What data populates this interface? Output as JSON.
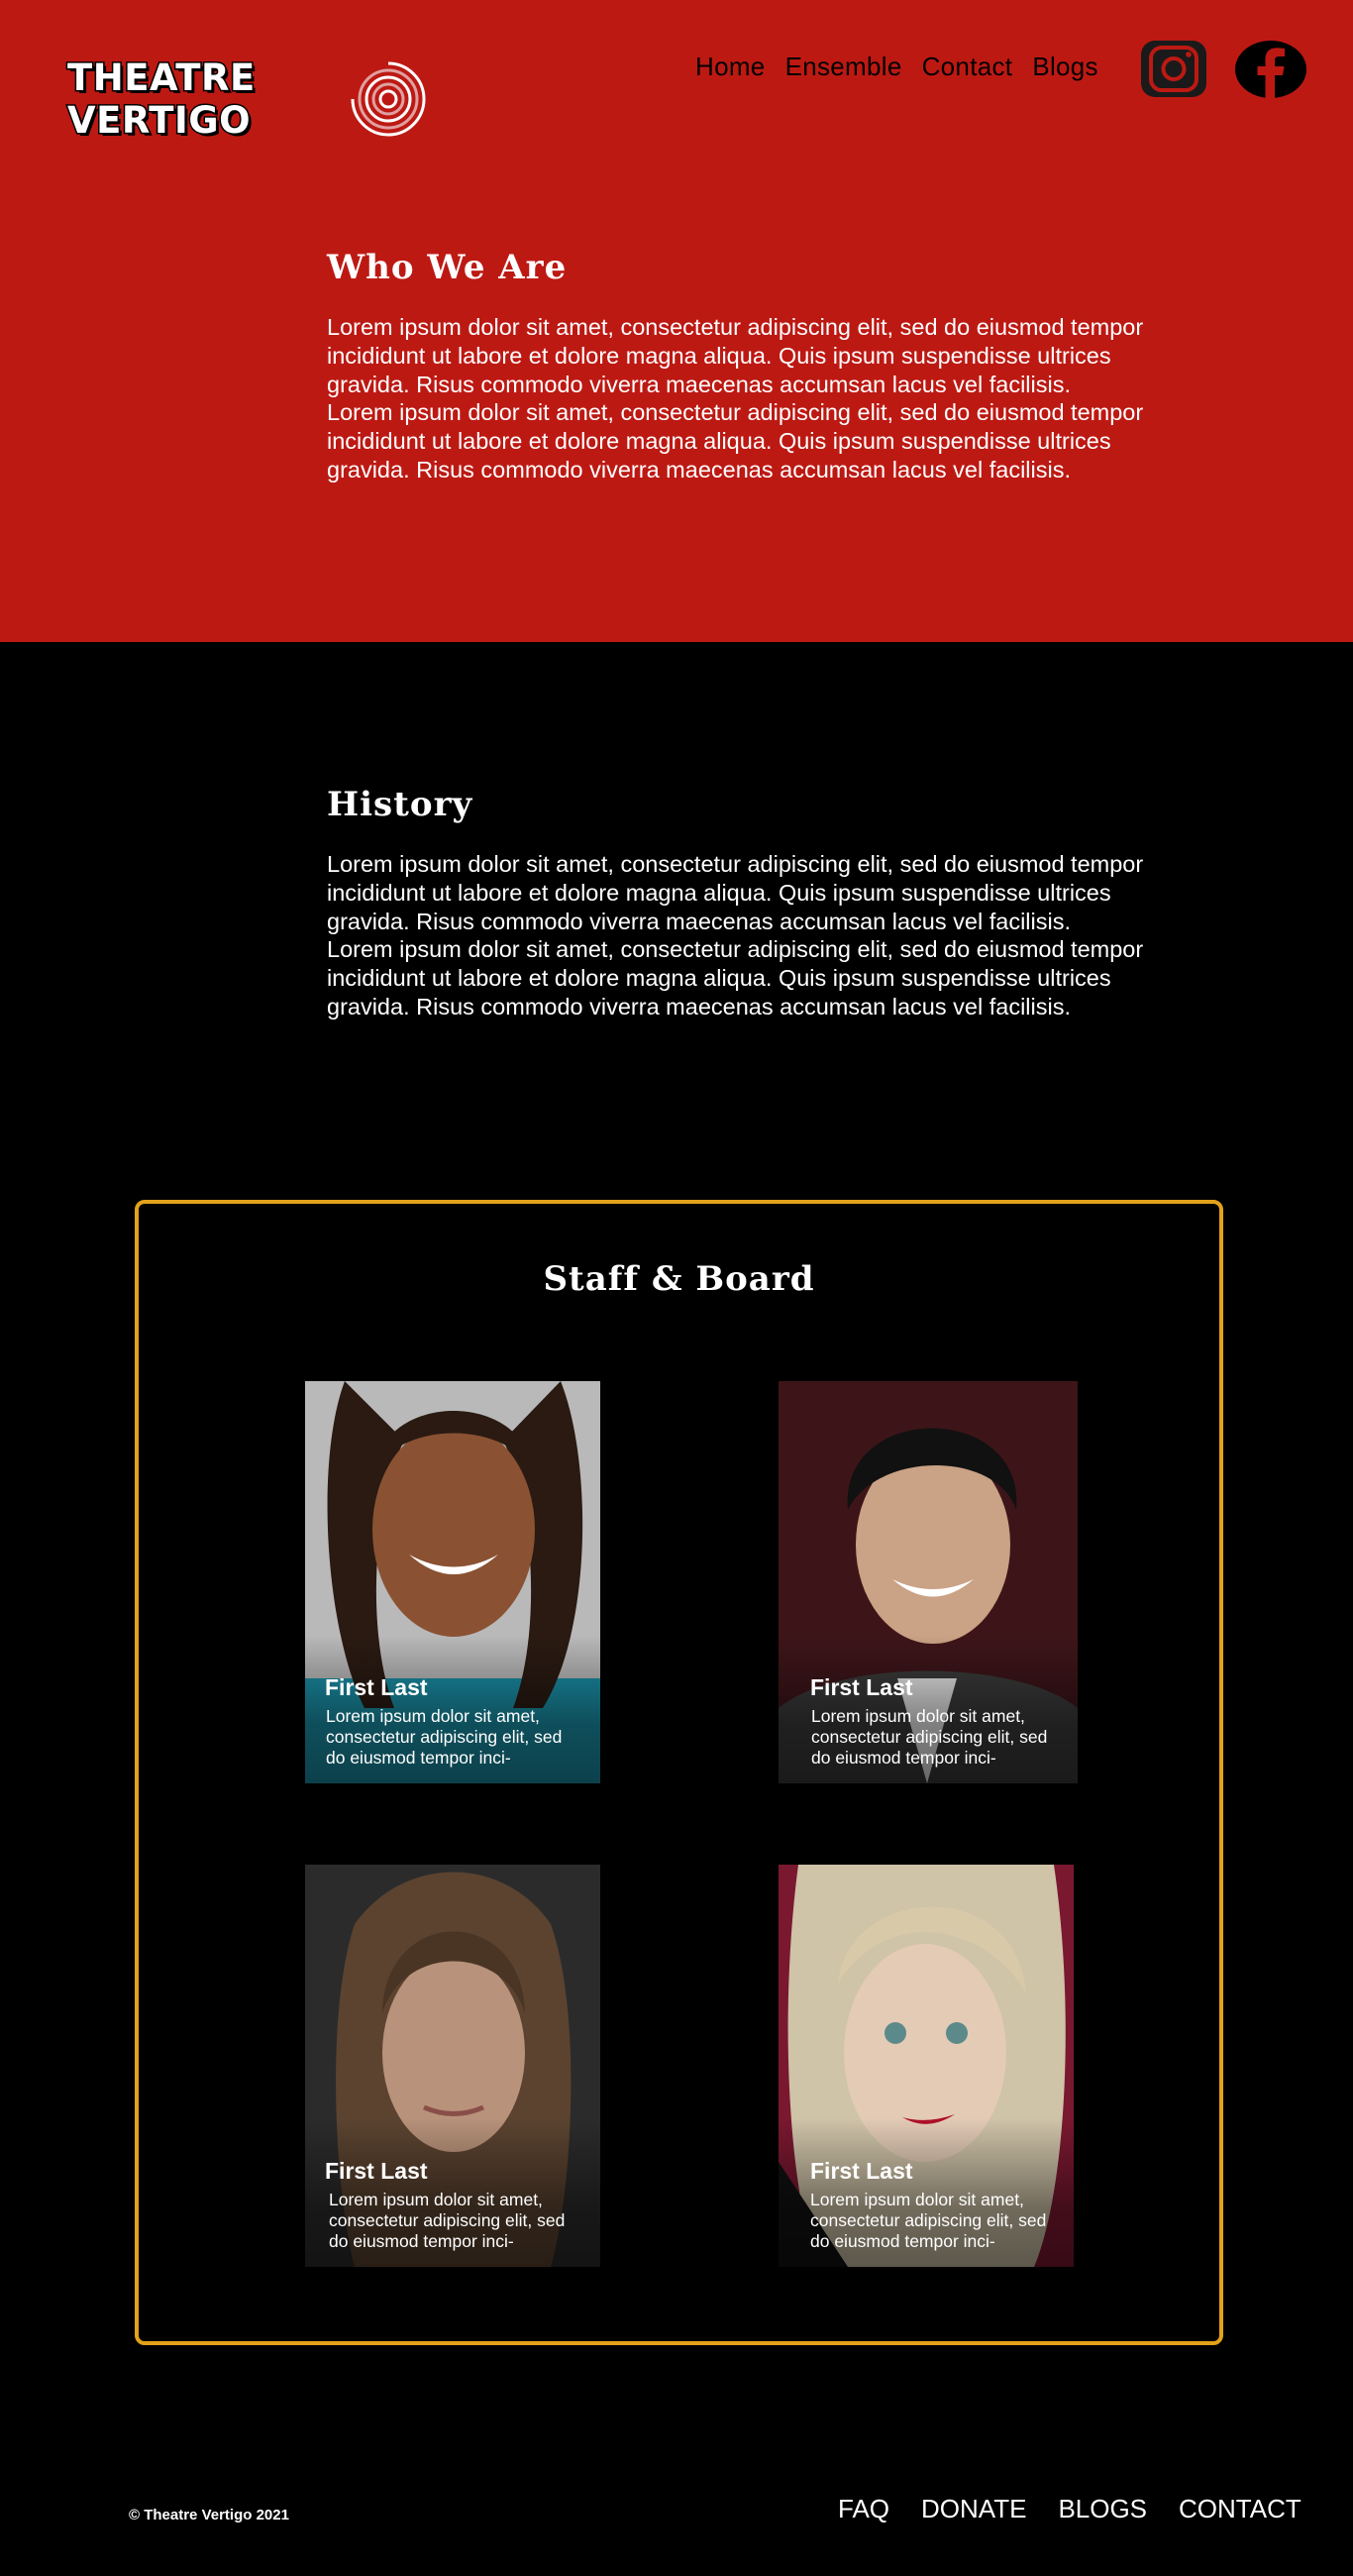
{
  "header": {
    "logo_text": "THEATRE VERTIGO",
    "nav": [
      "Home",
      "Ensemble",
      "Contact",
      "Blogs"
    ],
    "social": [
      "instagram-icon",
      "facebook-icon"
    ]
  },
  "who_we_are": {
    "title": "Who We Are",
    "paragraphs": [
      "Lorem ipsum dolor sit amet, consectetur adipiscing elit, sed do eiusmod tempor incididunt ut labore et dolore magna aliqua. Quis ipsum suspendisse ultrices gravida. Risus commodo viverra maecenas accumsan lacus vel facilisis.",
      "Lorem ipsum dolor sit amet, consectetur adipiscing elit, sed do eiusmod tempor incididunt ut labore et dolore magna aliqua. Quis ipsum suspendisse ultrices gravida. Risus commodo viverra maecenas accumsan lacus vel facilisis."
    ]
  },
  "history": {
    "title": "History",
    "paragraphs": [
      "Lorem ipsum dolor sit amet, consectetur adipiscing elit, sed do eiusmod tempor incididunt ut labore et dolore magna aliqua. Quis ipsum suspendisse ultrices gravida. Risus commodo viverra maecenas accumsan lacus vel facilisis.",
      "Lorem ipsum dolor sit amet, consectetur adipiscing elit, sed do eiusmod tempor incididunt ut labore et dolore magna aliqua. Quis ipsum suspendisse ultrices gravida. Risus commodo viverra maecenas accumsan lacus vel facilisis."
    ]
  },
  "staff": {
    "title": "Staff & Board",
    "members": [
      {
        "name": "First Last",
        "bio": "Lorem ipsum dolor sit amet, consectetur adipiscing elit, sed do eiusmod tempor inci-"
      },
      {
        "name": "First Last",
        "bio": "Lorem ipsum dolor sit amet, consectetur adipiscing elit, sed do eiusmod tempor inci-"
      },
      {
        "name": "First Last",
        "bio": "Lorem ipsum dolor sit amet, consectetur adipiscing elit, sed do eiusmod tempor inci-"
      },
      {
        "name": "First Last",
        "bio": "Lorem ipsum dolor sit amet, consectetur adipiscing elit, sed do eiusmod tempor inci-"
      }
    ]
  },
  "footer": {
    "copyright": "© Theatre Vertigo 2021",
    "links": [
      "FAQ",
      "DONATE",
      "BLOGS",
      "CONTACT"
    ]
  },
  "colors": {
    "header_red": "#bd1913",
    "background": "#000000",
    "staff_border": "#e3a219",
    "text": "#ffffff"
  }
}
